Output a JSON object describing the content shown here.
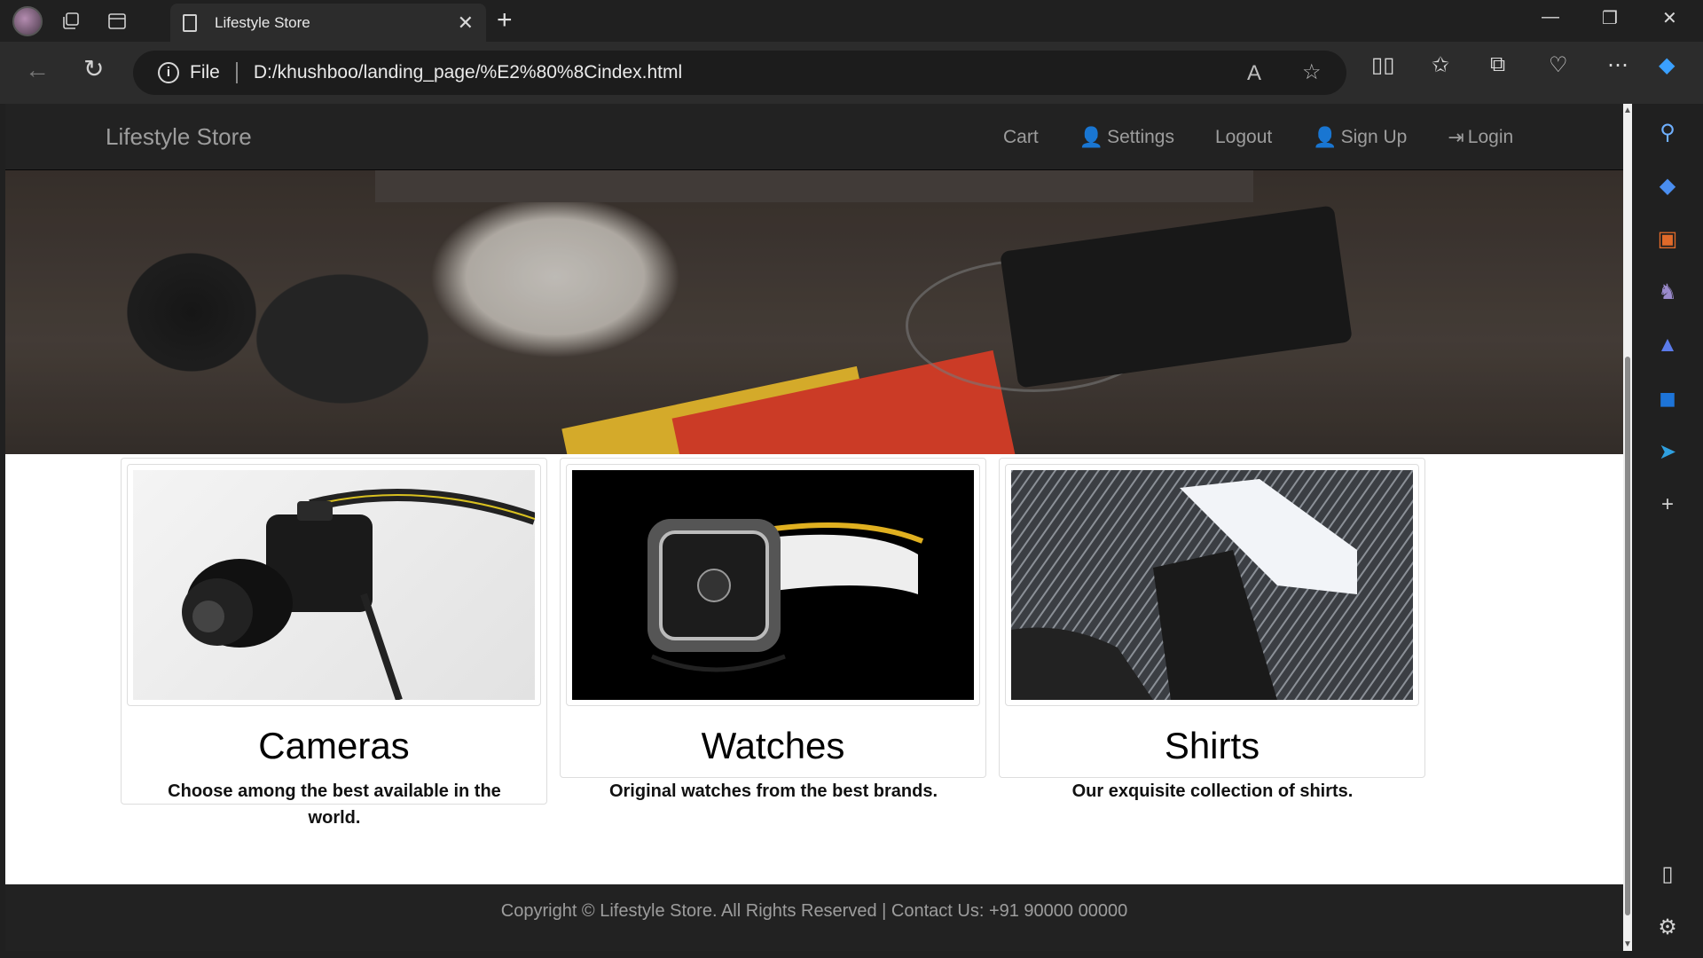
{
  "browser": {
    "tab_title": "Lifestyle Store",
    "address_scheme": "File",
    "address_url": "D:/khushboo/landing_page/%E2%80%8Cindex.html"
  },
  "site": {
    "brand": "Lifestyle Store",
    "nav": {
      "cart": "Cart",
      "settings": "Settings",
      "logout": "Logout",
      "signup": "Sign Up",
      "login": "Login"
    }
  },
  "products": [
    {
      "title": "Cameras",
      "desc": "Choose among the best available in the world."
    },
    {
      "title": "Watches",
      "desc": "Original watches from the best brands."
    },
    {
      "title": "Shirts",
      "desc": "Our exquisite collection of shirts."
    }
  ],
  "footer": {
    "text": "Copyright © Lifestyle Store. All Rights Reserved | Contact Us: +91 90000 00000"
  }
}
